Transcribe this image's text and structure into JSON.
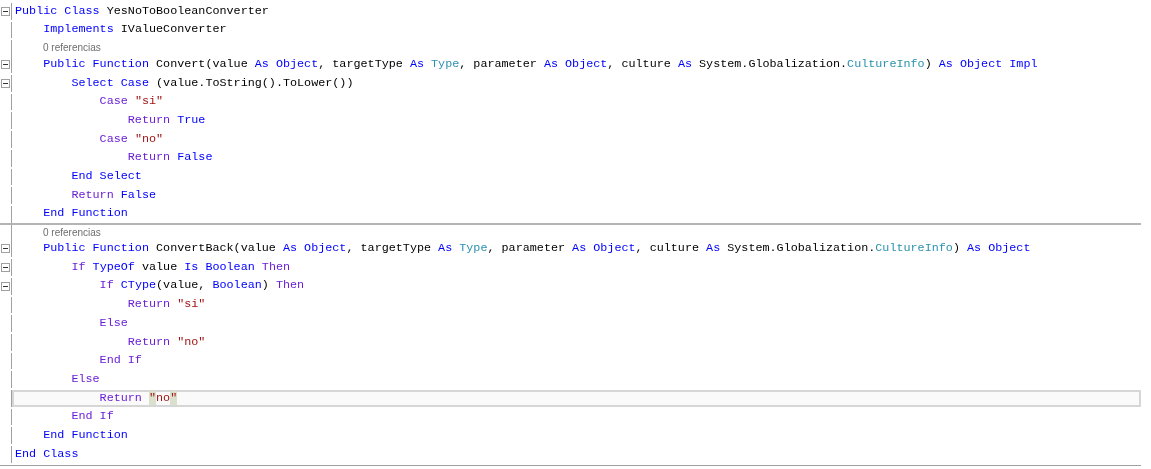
{
  "editor": {
    "lines": [
      {
        "kind": "code",
        "fold": true,
        "current": false,
        "separator": false,
        "tokens": [
          {
            "kind": "keyword",
            "text": "Public Class "
          },
          {
            "kind": "plain",
            "text": "YesNoToBooleanConverter"
          }
        ]
      },
      {
        "kind": "code",
        "fold": false,
        "current": false,
        "separator": false,
        "tokens": [
          {
            "kind": "keyword",
            "text": "    Implements "
          },
          {
            "kind": "plain",
            "text": "IValueConverter"
          }
        ]
      },
      {
        "kind": "codelens",
        "text": "0 referencias"
      },
      {
        "kind": "code",
        "fold": true,
        "current": false,
        "separator": false,
        "tokens": [
          {
            "kind": "keyword",
            "text": "    Public Function "
          },
          {
            "kind": "plain",
            "text": "Convert(value "
          },
          {
            "kind": "keyword",
            "text": "As Object"
          },
          {
            "kind": "plain",
            "text": ", targetType "
          },
          {
            "kind": "keyword",
            "text": "As "
          },
          {
            "kind": "type",
            "text": "Type"
          },
          {
            "kind": "plain",
            "text": ", parameter "
          },
          {
            "kind": "keyword",
            "text": "As Object"
          },
          {
            "kind": "plain",
            "text": ", culture "
          },
          {
            "kind": "keyword",
            "text": "As "
          },
          {
            "kind": "plain",
            "text": "System.Globalization."
          },
          {
            "kind": "type",
            "text": "CultureInfo"
          },
          {
            "kind": "plain",
            "text": ") "
          },
          {
            "kind": "keyword",
            "text": "As Object Impl"
          }
        ]
      },
      {
        "kind": "code",
        "fold": true,
        "current": false,
        "separator": false,
        "tokens": [
          {
            "kind": "keyword",
            "text": "        Select Case "
          },
          {
            "kind": "plain",
            "text": "(value.ToString().ToLower())"
          }
        ]
      },
      {
        "kind": "code",
        "fold": false,
        "current": false,
        "separator": false,
        "tokens": [
          {
            "kind": "control",
            "text": "            Case "
          },
          {
            "kind": "string",
            "text": "\"si\""
          }
        ]
      },
      {
        "kind": "code",
        "fold": false,
        "current": false,
        "separator": false,
        "tokens": [
          {
            "kind": "control",
            "text": "                Return "
          },
          {
            "kind": "keyword",
            "text": "True"
          }
        ]
      },
      {
        "kind": "code",
        "fold": false,
        "current": false,
        "separator": false,
        "tokens": [
          {
            "kind": "control",
            "text": "            Case "
          },
          {
            "kind": "string",
            "text": "\"no\""
          }
        ]
      },
      {
        "kind": "code",
        "fold": false,
        "current": false,
        "separator": false,
        "tokens": [
          {
            "kind": "control",
            "text": "                Return "
          },
          {
            "kind": "keyword",
            "text": "False"
          }
        ]
      },
      {
        "kind": "code",
        "fold": false,
        "current": false,
        "separator": false,
        "tokens": [
          {
            "kind": "keyword",
            "text": "        End Select"
          }
        ]
      },
      {
        "kind": "code",
        "fold": false,
        "current": false,
        "separator": false,
        "tokens": [
          {
            "kind": "control",
            "text": "        Return "
          },
          {
            "kind": "keyword",
            "text": "False"
          }
        ]
      },
      {
        "kind": "code",
        "fold": false,
        "current": false,
        "separator": true,
        "tokens": [
          {
            "kind": "keyword",
            "text": "    End Function"
          }
        ]
      },
      {
        "kind": "codelens",
        "text": "0 referencias"
      },
      {
        "kind": "code",
        "fold": true,
        "current": false,
        "separator": false,
        "tokens": [
          {
            "kind": "keyword",
            "text": "    Public Function "
          },
          {
            "kind": "plain",
            "text": "ConvertBack(value "
          },
          {
            "kind": "keyword",
            "text": "As Object"
          },
          {
            "kind": "plain",
            "text": ", targetType "
          },
          {
            "kind": "keyword",
            "text": "As "
          },
          {
            "kind": "type",
            "text": "Type"
          },
          {
            "kind": "plain",
            "text": ", parameter "
          },
          {
            "kind": "keyword",
            "text": "As Object"
          },
          {
            "kind": "plain",
            "text": ", culture "
          },
          {
            "kind": "keyword",
            "text": "As "
          },
          {
            "kind": "plain",
            "text": "System.Globalization."
          },
          {
            "kind": "type",
            "text": "CultureInfo"
          },
          {
            "kind": "plain",
            "text": ") "
          },
          {
            "kind": "keyword",
            "text": "As Object"
          }
        ]
      },
      {
        "kind": "code",
        "fold": true,
        "current": false,
        "separator": false,
        "tokens": [
          {
            "kind": "control",
            "text": "        If "
          },
          {
            "kind": "keyword",
            "text": "TypeOf "
          },
          {
            "kind": "plain",
            "text": "value "
          },
          {
            "kind": "keyword",
            "text": "Is Boolean "
          },
          {
            "kind": "control",
            "text": "Then"
          }
        ]
      },
      {
        "kind": "code",
        "fold": true,
        "current": false,
        "separator": false,
        "tokens": [
          {
            "kind": "control",
            "text": "            If "
          },
          {
            "kind": "keyword",
            "text": "CType"
          },
          {
            "kind": "plain",
            "text": "(value, "
          },
          {
            "kind": "keyword",
            "text": "Boolean"
          },
          {
            "kind": "plain",
            "text": ") "
          },
          {
            "kind": "control",
            "text": "Then"
          }
        ]
      },
      {
        "kind": "code",
        "fold": false,
        "current": false,
        "separator": false,
        "tokens": [
          {
            "kind": "control",
            "text": "                Return "
          },
          {
            "kind": "string",
            "text": "\"si\""
          }
        ]
      },
      {
        "kind": "code",
        "fold": false,
        "current": false,
        "separator": false,
        "tokens": [
          {
            "kind": "control",
            "text": "            Else"
          }
        ]
      },
      {
        "kind": "code",
        "fold": false,
        "current": false,
        "separator": false,
        "tokens": [
          {
            "kind": "control",
            "text": "                Return "
          },
          {
            "kind": "string",
            "text": "\"no\""
          }
        ]
      },
      {
        "kind": "code",
        "fold": false,
        "current": false,
        "separator": false,
        "tokens": [
          {
            "kind": "control",
            "text": "            End If"
          }
        ]
      },
      {
        "kind": "code",
        "fold": false,
        "current": false,
        "separator": false,
        "tokens": [
          {
            "kind": "control",
            "text": "        Else"
          }
        ]
      },
      {
        "kind": "code",
        "fold": false,
        "current": true,
        "separator": false,
        "tokens": [
          {
            "kind": "control",
            "text": "            Return "
          },
          {
            "kind": "match",
            "text": "\""
          },
          {
            "kind": "string",
            "text": "no"
          },
          {
            "kind": "match",
            "text": "\""
          }
        ]
      },
      {
        "kind": "code",
        "fold": false,
        "current": false,
        "separator": false,
        "tokens": [
          {
            "kind": "control",
            "text": "        End If"
          }
        ]
      },
      {
        "kind": "code",
        "fold": false,
        "current": false,
        "separator": false,
        "tokens": [
          {
            "kind": "keyword",
            "text": "    End Function"
          }
        ]
      },
      {
        "kind": "code",
        "fold": false,
        "current": false,
        "separator": false,
        "tokens": [
          {
            "kind": "keyword",
            "text": "End Class"
          }
        ]
      }
    ]
  }
}
